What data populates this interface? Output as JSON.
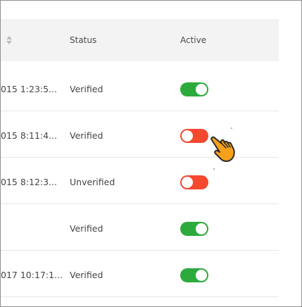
{
  "header": {
    "sort_icon": "sort-arrows-icon",
    "status_label": "Status",
    "active_label": "Active"
  },
  "rows": [
    {
      "date": "015 1:23:5...",
      "status": "Verified",
      "active": true
    },
    {
      "date": "015 8:11:4...",
      "status": "Verified",
      "active": false
    },
    {
      "date": "015 8:12:3...",
      "status": "Unverified",
      "active": false
    },
    {
      "date": "",
      "status": "Verified",
      "active": true
    },
    {
      "date": "017 10:17:1...",
      "status": "Verified",
      "active": true
    }
  ],
  "colors": {
    "toggle_on": "#2cab3c",
    "toggle_off": "#f4482f",
    "header_bg": "#f3f3f3"
  },
  "cursor_icon": "pointing-hand-cursor-icon"
}
